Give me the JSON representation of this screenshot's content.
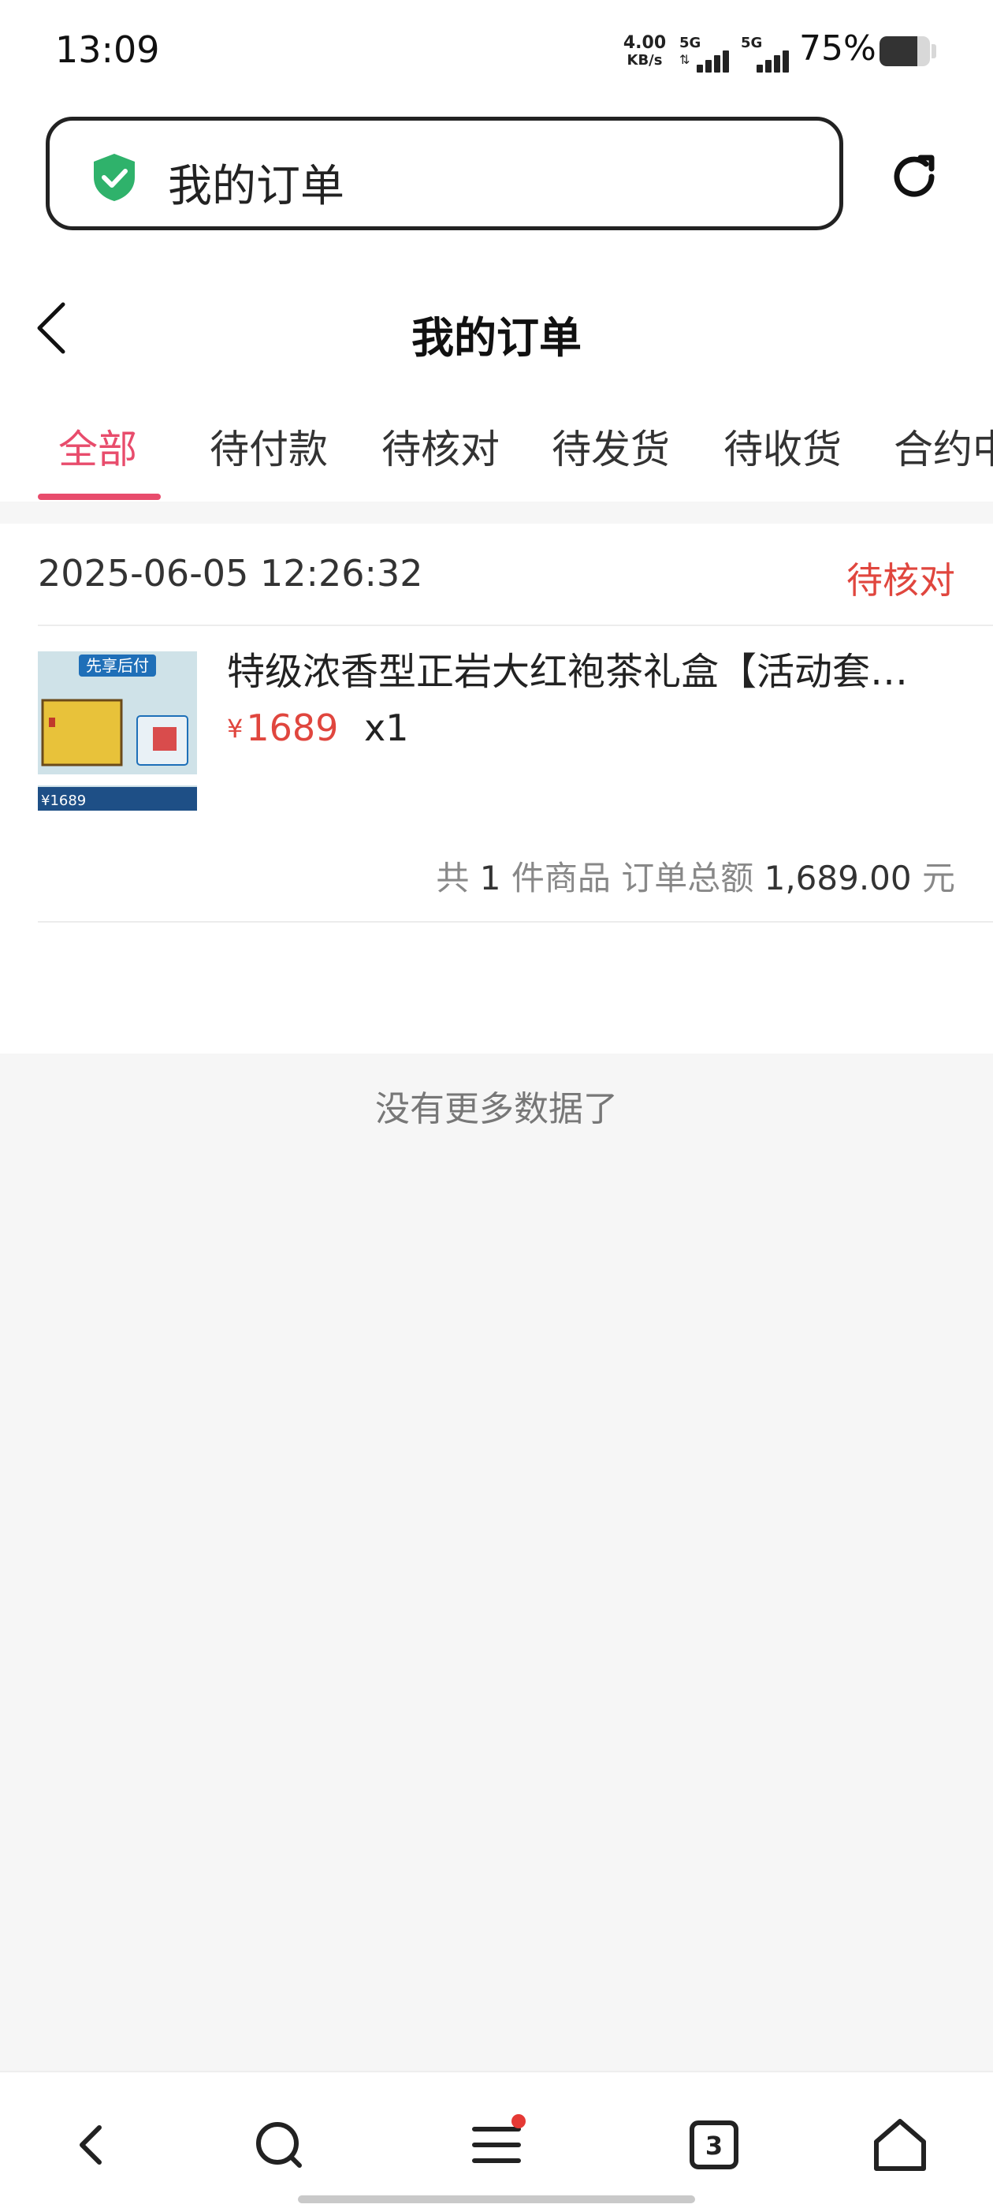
{
  "status_bar": {
    "time": "13:09",
    "network_speed_value": "4.00",
    "network_speed_unit": "KB/s",
    "sim1_label": "5G",
    "sim2_label": "5G",
    "battery_percent_text": "75%",
    "battery_level": 0.75
  },
  "address_bar": {
    "text": "我的订单",
    "shield_color": "#2fb26b",
    "shield_icon": "shield-check-icon",
    "refresh_icon": "refresh-icon"
  },
  "header": {
    "title": "我的订单",
    "back_icon": "chevron-left-icon"
  },
  "tabs": [
    {
      "label": "全部",
      "active": true
    },
    {
      "label": "待付款",
      "active": false
    },
    {
      "label": "待核对",
      "active": false
    },
    {
      "label": "待发货",
      "active": false
    },
    {
      "label": "待收货",
      "active": false
    },
    {
      "label": "合约中",
      "active": false
    }
  ],
  "accent_color": "#e84c6c",
  "orders": [
    {
      "datetime": "2025-06-05 12:26:32",
      "status": "待核对",
      "product": {
        "title": "特级浓香型正岩大红袍茶礼盒【活动套…",
        "price_symbol": "¥",
        "price": "1689",
        "quantity": "x1",
        "thumb_badge": "先享后付",
        "thumb_price": "¥1689"
      },
      "summary": {
        "prefix": "共",
        "count": "1",
        "items_label": "件商品",
        "total_label": "订单总额",
        "total_amount": "1,689.00",
        "currency": "元"
      }
    }
  ],
  "list_end_text": "没有更多数据了",
  "bottom_nav": {
    "back_icon": "back-arrow-icon",
    "search_icon": "search-icon",
    "menu_icon": "menu-icon",
    "menu_has_badge": true,
    "tabs_count": "3",
    "home_icon": "home-icon"
  }
}
